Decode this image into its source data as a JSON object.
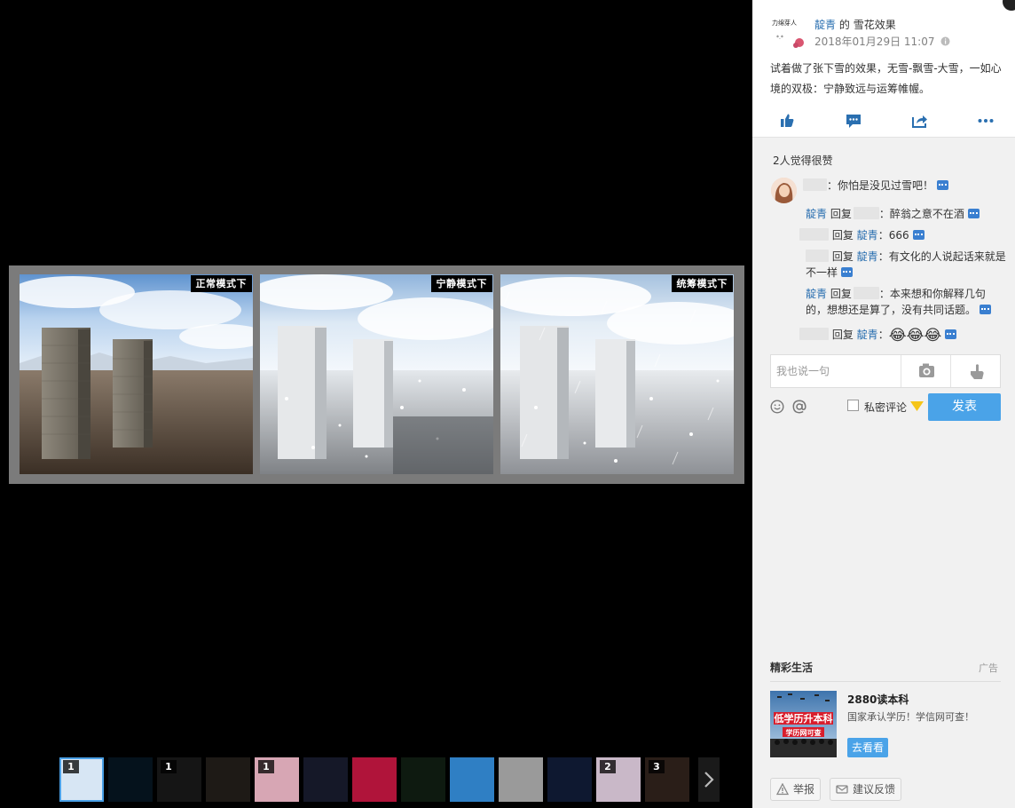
{
  "viewer": {
    "panels": [
      {
        "label": "正常模式下",
        "mode": "normal"
      },
      {
        "label": "宁静模式下",
        "mode": "snow"
      },
      {
        "label": "统筹模式下",
        "mode": "heavy"
      }
    ],
    "thumbnails": [
      {
        "badge": "1",
        "selected": true,
        "color": "#d7e6f4"
      },
      {
        "badge": "",
        "selected": false,
        "color": "#05121c"
      },
      {
        "badge": "1",
        "selected": false,
        "color": "#151515"
      },
      {
        "badge": "",
        "selected": false,
        "color": "#1e1a16"
      },
      {
        "badge": "1",
        "selected": false,
        "color": "#d7a6b4"
      },
      {
        "badge": "",
        "selected": false,
        "color": "#151828"
      },
      {
        "badge": "",
        "selected": false,
        "color": "#b0143a"
      },
      {
        "badge": "",
        "selected": false,
        "color": "#0e1a10"
      },
      {
        "badge": "",
        "selected": false,
        "color": "#2f7fc4"
      },
      {
        "badge": "",
        "selected": false,
        "color": "#9a9a9a"
      },
      {
        "badge": "",
        "selected": false,
        "color": "#0e1830"
      },
      {
        "badge": "2",
        "selected": false,
        "color": "#c9b8c8"
      },
      {
        "badge": "3",
        "selected": false,
        "color": "#2a1e18"
      }
    ]
  },
  "post": {
    "avatar_text": "力绵芽人",
    "author": "靛青",
    "of": "的",
    "album": "雪花效果",
    "time": "2018年01月29日 11:07",
    "text": "试着做了张下雪的效果，无雪-飘雪-大雪，一如心境的双极：宁静致远与运筹帷幄。"
  },
  "likes": "2人觉得很赞",
  "comments": {
    "c1": {
      "text": "：你怕是没见过雪吧！"
    },
    "r1": {
      "name": "靛青",
      "reply": "回复",
      "text": "：醉翁之意不在酒"
    },
    "r2": {
      "reply": "回复",
      "name": "靛青",
      "text": "：666"
    },
    "r3": {
      "reply": "回复",
      "name": "靛青",
      "text": "：有文化的人说起话来就是不一样"
    },
    "r4": {
      "name": "靛青",
      "reply": "回复",
      "text": "：本来想和你解释几句的，想想还是算了，没有共同话题。"
    },
    "r5": {
      "reply": "回复",
      "name": "靛青",
      "text": "：",
      "emoji": "😂😂😂"
    }
  },
  "comment_form": {
    "placeholder": "我也说一句",
    "private_label": "私密评论",
    "send_label": "发表"
  },
  "ad": {
    "section_title": "精彩生活",
    "tag": "广告",
    "name": "2880读本科",
    "desc": "国家承认学历！学信网可查！",
    "button": "去看看",
    "banner1": "低学历升本科",
    "banner2": "学历网可查"
  },
  "footer": {
    "report": "举报",
    "feedback": "建议反馈"
  },
  "colors": {
    "accent": "#4aa3e8",
    "link": "#2a6fb0"
  }
}
